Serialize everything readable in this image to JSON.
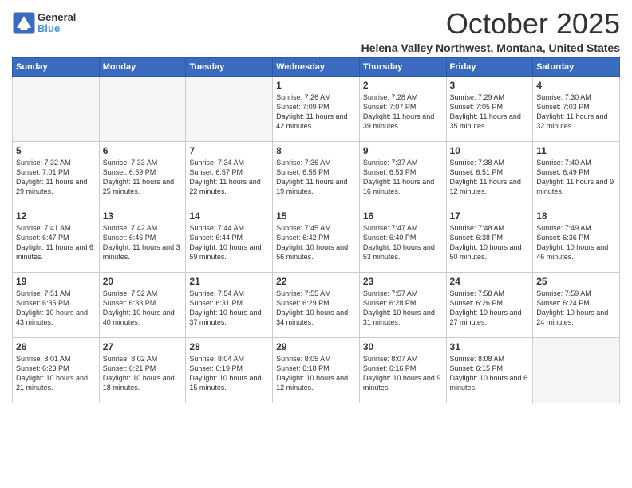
{
  "header": {
    "logo_general": "General",
    "logo_blue": "Blue",
    "month_title": "October 2025",
    "location": "Helena Valley Northwest, Montana, United States"
  },
  "days_of_week": [
    "Sunday",
    "Monday",
    "Tuesday",
    "Wednesday",
    "Thursday",
    "Friday",
    "Saturday"
  ],
  "weeks": [
    [
      {
        "day": "",
        "empty": true
      },
      {
        "day": "",
        "empty": true
      },
      {
        "day": "",
        "empty": true
      },
      {
        "day": "1",
        "sunrise": "7:26 AM",
        "sunset": "7:09 PM",
        "daylight": "11 hours and 42 minutes."
      },
      {
        "day": "2",
        "sunrise": "7:28 AM",
        "sunset": "7:07 PM",
        "daylight": "11 hours and 39 minutes."
      },
      {
        "day": "3",
        "sunrise": "7:29 AM",
        "sunset": "7:05 PM",
        "daylight": "11 hours and 35 minutes."
      },
      {
        "day": "4",
        "sunrise": "7:30 AM",
        "sunset": "7:03 PM",
        "daylight": "11 hours and 32 minutes."
      }
    ],
    [
      {
        "day": "5",
        "sunrise": "7:32 AM",
        "sunset": "7:01 PM",
        "daylight": "11 hours and 29 minutes."
      },
      {
        "day": "6",
        "sunrise": "7:33 AM",
        "sunset": "6:59 PM",
        "daylight": "11 hours and 25 minutes."
      },
      {
        "day": "7",
        "sunrise": "7:34 AM",
        "sunset": "6:57 PM",
        "daylight": "11 hours and 22 minutes."
      },
      {
        "day": "8",
        "sunrise": "7:36 AM",
        "sunset": "6:55 PM",
        "daylight": "11 hours and 19 minutes."
      },
      {
        "day": "9",
        "sunrise": "7:37 AM",
        "sunset": "6:53 PM",
        "daylight": "11 hours and 16 minutes."
      },
      {
        "day": "10",
        "sunrise": "7:38 AM",
        "sunset": "6:51 PM",
        "daylight": "11 hours and 12 minutes."
      },
      {
        "day": "11",
        "sunrise": "7:40 AM",
        "sunset": "6:49 PM",
        "daylight": "11 hours and 9 minutes."
      }
    ],
    [
      {
        "day": "12",
        "sunrise": "7:41 AM",
        "sunset": "6:47 PM",
        "daylight": "11 hours and 6 minutes."
      },
      {
        "day": "13",
        "sunrise": "7:42 AM",
        "sunset": "6:46 PM",
        "daylight": "11 hours and 3 minutes."
      },
      {
        "day": "14",
        "sunrise": "7:44 AM",
        "sunset": "6:44 PM",
        "daylight": "10 hours and 59 minutes."
      },
      {
        "day": "15",
        "sunrise": "7:45 AM",
        "sunset": "6:42 PM",
        "daylight": "10 hours and 56 minutes."
      },
      {
        "day": "16",
        "sunrise": "7:47 AM",
        "sunset": "6:40 PM",
        "daylight": "10 hours and 53 minutes."
      },
      {
        "day": "17",
        "sunrise": "7:48 AM",
        "sunset": "6:38 PM",
        "daylight": "10 hours and 50 minutes."
      },
      {
        "day": "18",
        "sunrise": "7:49 AM",
        "sunset": "6:36 PM",
        "daylight": "10 hours and 46 minutes."
      }
    ],
    [
      {
        "day": "19",
        "sunrise": "7:51 AM",
        "sunset": "6:35 PM",
        "daylight": "10 hours and 43 minutes."
      },
      {
        "day": "20",
        "sunrise": "7:52 AM",
        "sunset": "6:33 PM",
        "daylight": "10 hours and 40 minutes."
      },
      {
        "day": "21",
        "sunrise": "7:54 AM",
        "sunset": "6:31 PM",
        "daylight": "10 hours and 37 minutes."
      },
      {
        "day": "22",
        "sunrise": "7:55 AM",
        "sunset": "6:29 PM",
        "daylight": "10 hours and 34 minutes."
      },
      {
        "day": "23",
        "sunrise": "7:57 AM",
        "sunset": "6:28 PM",
        "daylight": "10 hours and 31 minutes."
      },
      {
        "day": "24",
        "sunrise": "7:58 AM",
        "sunset": "6:26 PM",
        "daylight": "10 hours and 27 minutes."
      },
      {
        "day": "25",
        "sunrise": "7:59 AM",
        "sunset": "6:24 PM",
        "daylight": "10 hours and 24 minutes."
      }
    ],
    [
      {
        "day": "26",
        "sunrise": "8:01 AM",
        "sunset": "6:23 PM",
        "daylight": "10 hours and 21 minutes."
      },
      {
        "day": "27",
        "sunrise": "8:02 AM",
        "sunset": "6:21 PM",
        "daylight": "10 hours and 18 minutes."
      },
      {
        "day": "28",
        "sunrise": "8:04 AM",
        "sunset": "6:19 PM",
        "daylight": "10 hours and 15 minutes."
      },
      {
        "day": "29",
        "sunrise": "8:05 AM",
        "sunset": "6:18 PM",
        "daylight": "10 hours and 12 minutes."
      },
      {
        "day": "30",
        "sunrise": "8:07 AM",
        "sunset": "6:16 PM",
        "daylight": "10 hours and 9 minutes."
      },
      {
        "day": "31",
        "sunrise": "8:08 AM",
        "sunset": "6:15 PM",
        "daylight": "10 hours and 6 minutes."
      },
      {
        "day": "",
        "empty": true
      }
    ]
  ]
}
